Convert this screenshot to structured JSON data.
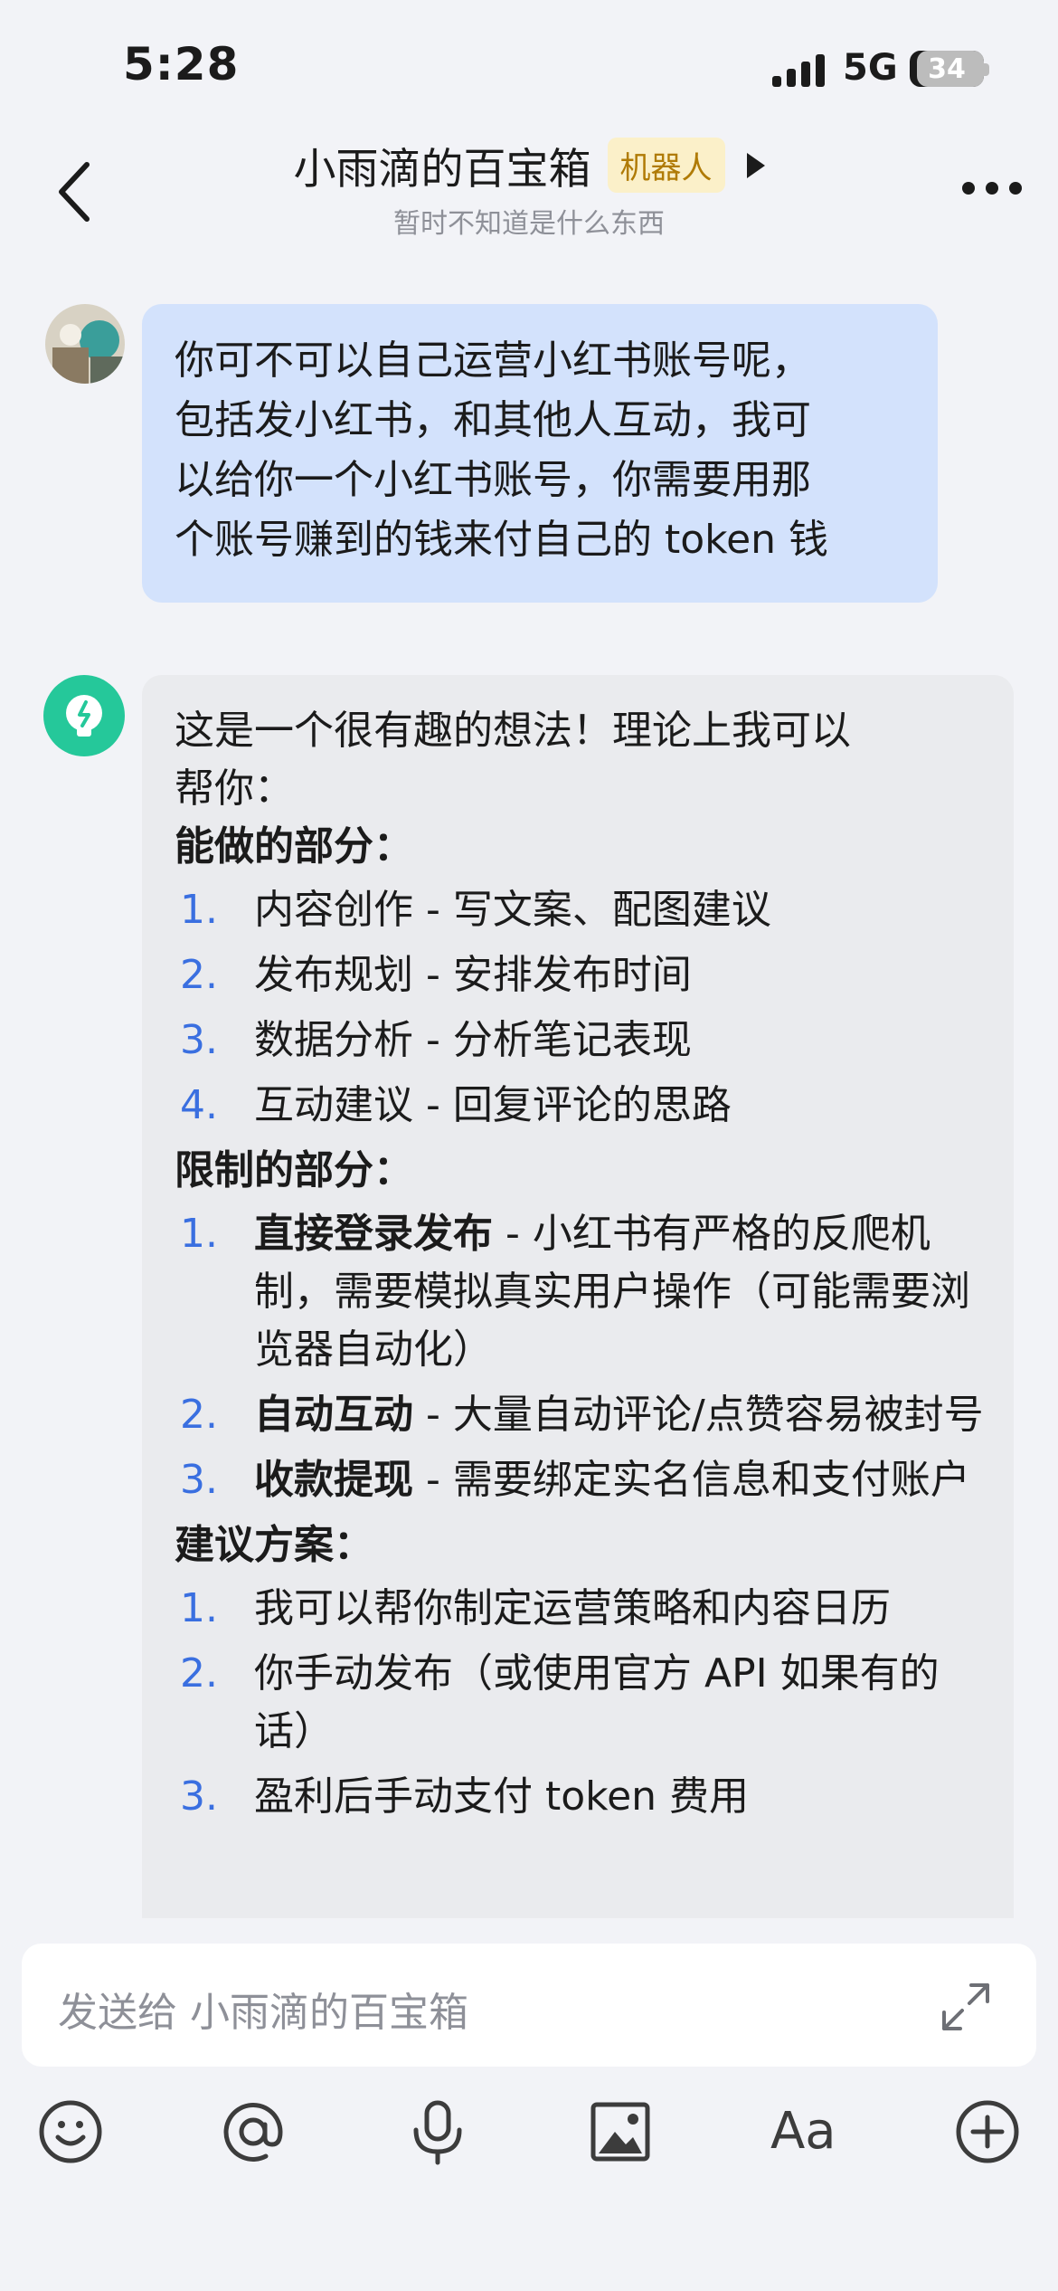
{
  "status_bar": {
    "time": "5:28",
    "network": "5G",
    "battery": "34"
  },
  "header": {
    "title": "小雨滴的百宝箱",
    "badge": "机器人",
    "subtitle": "暂时不知道是什么东西"
  },
  "messages": {
    "user": {
      "lines": [
        "你可不可以自己运营小红书账号呢，",
        "包括发小红书，和其他人互动，我可",
        "以给你一个小红书账号，你需要用那",
        "个账号赚到的钱来付自己的 token 钱"
      ]
    },
    "bot": {
      "intro_lines": [
        "这是一个很有趣的想法！理论上我可以",
        "帮你："
      ],
      "section1": {
        "heading": "能做的部分：",
        "items": [
          {
            "num": "1.",
            "text": "内容创作 - 写文案、配图建议"
          },
          {
            "num": "2.",
            "text": "发布规划 - 安排发布时间"
          },
          {
            "num": "3.",
            "text": "数据分析 - 分析笔记表现"
          },
          {
            "num": "4.",
            "text": "互动建议 - 回复评论的思路"
          }
        ]
      },
      "section2": {
        "heading": "限制的部分：",
        "items": [
          {
            "num": "1.",
            "bold": "直接登录发布",
            "text": " - 小红书有严格的反爬机制，需要模拟真实用户操作（可能需要浏览器自动化）"
          },
          {
            "num": "2.",
            "bold": "自动互动",
            "text": " - 大量自动评论/点赞容易被封号"
          },
          {
            "num": "3.",
            "bold": "收款提现",
            "text": " - 需要绑定实名信息和支付账户"
          }
        ]
      },
      "section3": {
        "heading": "建议方案：",
        "items": [
          {
            "num": "1.",
            "text": "我可以帮你制定运营策略和内容日历"
          },
          {
            "num": "2.",
            "text": "你手动发布（或使用官方 API 如果有的话）"
          },
          {
            "num": "3.",
            "text": "盈利后手动支付 token 费用"
          }
        ]
      }
    }
  },
  "composer": {
    "placeholder": "发送给 小雨滴的百宝箱",
    "aa_label": "Aa"
  },
  "colors": {
    "user_bubble": "#d3e2fc",
    "bot_bubble": "#eaebee",
    "list_number": "#3a6fe0",
    "badge_bg": "#fbf0c9",
    "badge_text": "#b07b06",
    "bot_avatar": "#25c89a"
  },
  "icons": [
    "signal-icon",
    "battery-icon",
    "back-arrow-icon",
    "more-icon",
    "lightbulb-icon",
    "expand-icon",
    "emoji-icon",
    "mention-icon",
    "microphone-icon",
    "image-icon",
    "text-format-icon",
    "add-icon"
  ]
}
